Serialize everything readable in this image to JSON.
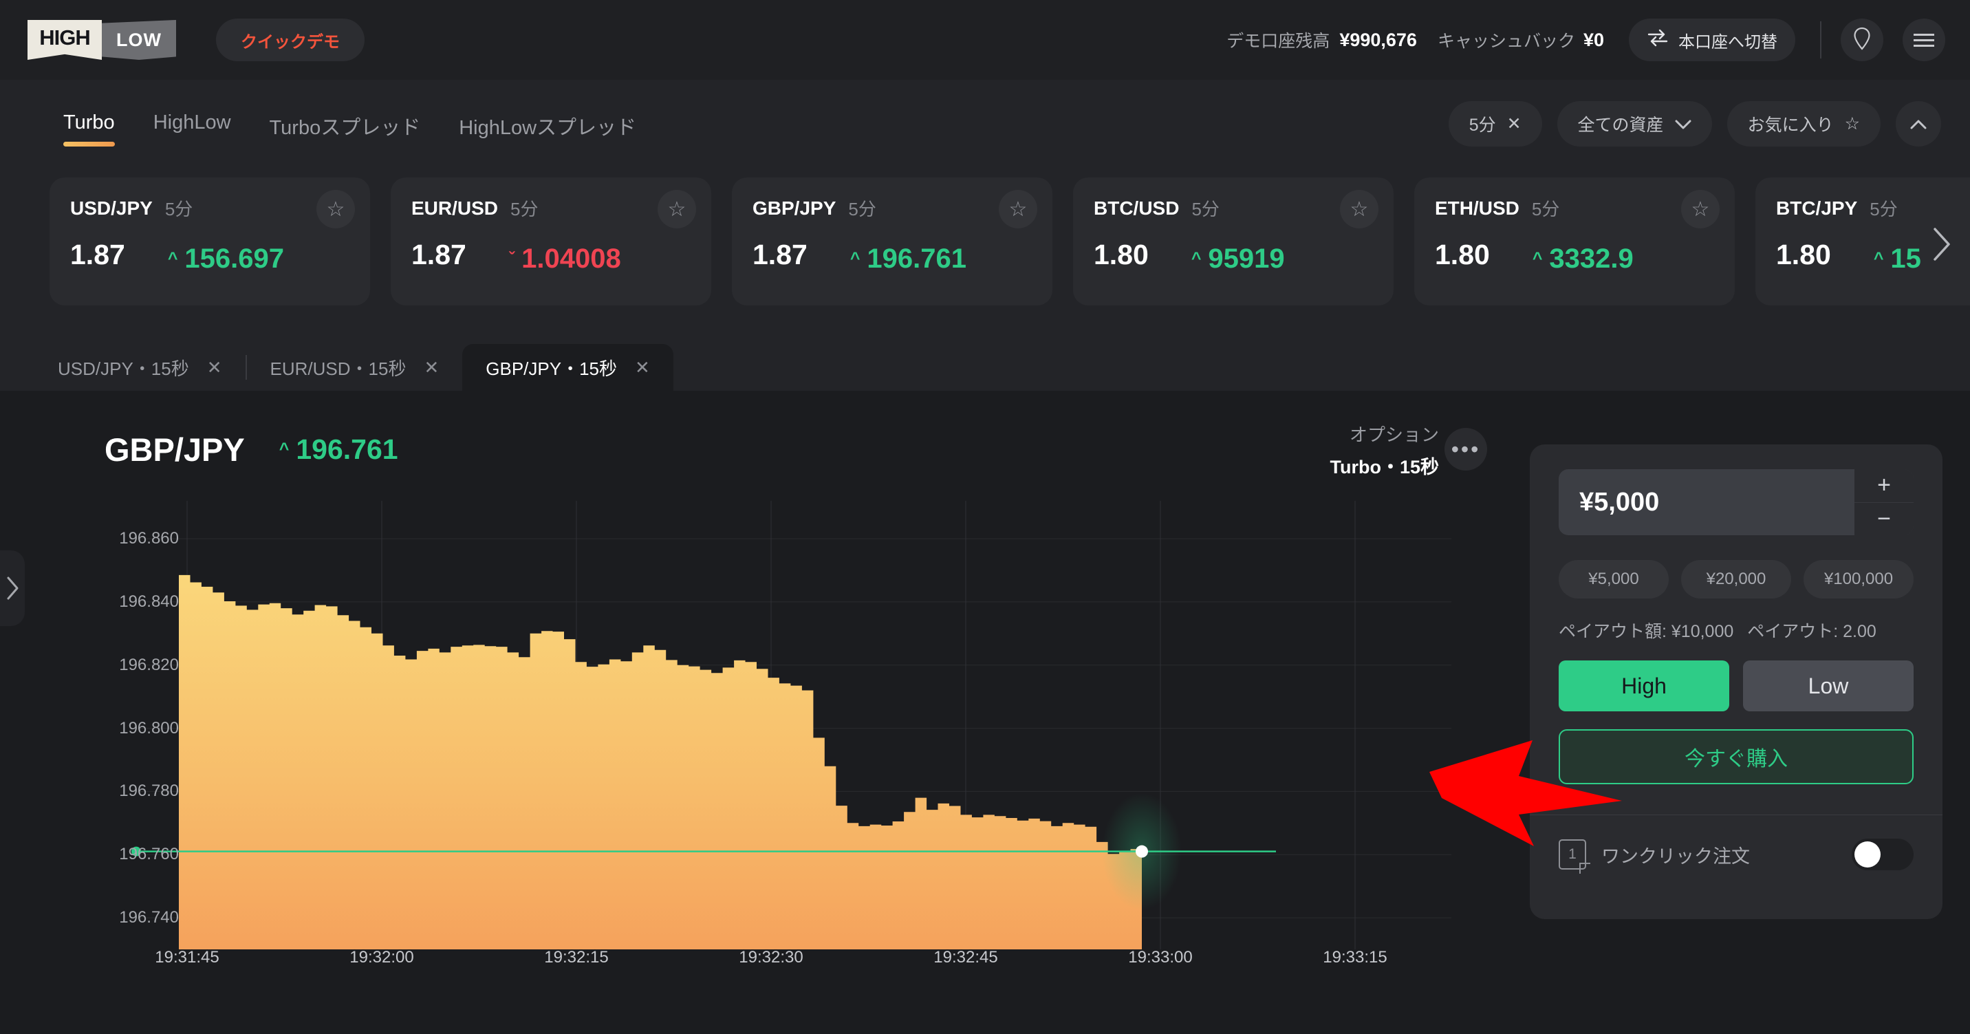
{
  "header": {
    "logo_high": "HIGH",
    "logo_low": "LOW",
    "quick_demo": "クイックデモ",
    "balance_label": "デモ口座残高",
    "balance_value": "¥990,676",
    "cashback_label": "キャッシュバック",
    "cashback_value": "¥0",
    "switch_account": "本口座へ切替",
    "switch_icon": "swap-icon",
    "notification_icon": "location-pin-icon",
    "menu_icon": "hamburger-menu-icon"
  },
  "nav": {
    "tabs": [
      {
        "label": "Turbo",
        "active": true
      },
      {
        "label": "HighLow",
        "active": false
      },
      {
        "label": "Turboスプレッド",
        "active": false
      },
      {
        "label": "HighLowスプレッド",
        "active": false
      }
    ],
    "filters": {
      "duration": "5分",
      "duration_close": "✕",
      "asset_filter": "全ての資産",
      "favorites": "お気に入り",
      "collapse": "^"
    }
  },
  "assets": [
    {
      "name": "USD/JPY",
      "duration": "5分",
      "multiplier": "1.87",
      "price": "156.697",
      "dir": "up",
      "caret": "^"
    },
    {
      "name": "EUR/USD",
      "duration": "5分",
      "multiplier": "1.87",
      "price": "1.04008",
      "dir": "down",
      "caret": "ˇ"
    },
    {
      "name": "GBP/JPY",
      "duration": "5分",
      "multiplier": "1.87",
      "price": "196.761",
      "dir": "up",
      "caret": "^"
    },
    {
      "name": "BTC/USD",
      "duration": "5分",
      "multiplier": "1.80",
      "price": "95919",
      "dir": "up",
      "caret": "^"
    },
    {
      "name": "ETH/USD",
      "duration": "5分",
      "multiplier": "1.80",
      "price": "3332.9",
      "dir": "up",
      "caret": "^"
    },
    {
      "name": "BTC/JPY",
      "duration": "5分",
      "multiplier": "1.80",
      "price": "15",
      "dir": "up",
      "caret": "^"
    }
  ],
  "chart_tabs": [
    {
      "label": "USD/JPY・15秒",
      "close": "✕",
      "active": false
    },
    {
      "label": "EUR/USD・15秒",
      "close": "✕",
      "active": false
    },
    {
      "label": "GBP/JPY・15秒",
      "close": "✕",
      "active": true
    }
  ],
  "chart_header": {
    "symbol": "GBP/JPY",
    "price": "196.761",
    "caret": "^",
    "option_label": "オプション",
    "option_value": "Turbo・15秒",
    "more_icon": "ellipsis-icon"
  },
  "panel": {
    "amount_value": "¥5,000",
    "increment": "+",
    "decrement": "−",
    "quick_amounts": [
      "¥5,000",
      "¥20,000",
      "¥100,000"
    ],
    "payout_amount_label": "ペイアウト額: ¥10,000",
    "payout_rate_label": "ペイアウト: 2.00",
    "high_label": "High",
    "low_label": "Low",
    "buy_label": "今すぐ購入",
    "oneclick_label": "ワンクリック注文",
    "oneclick_icon": "one-click-icon",
    "oneclick_on": true
  },
  "colors": {
    "accent_green": "#2ecc87",
    "accent_red": "#f04452",
    "brand_orange": "#f0a84e",
    "panel_bg": "#2a2b2f",
    "page_bg": "#1b1c1f"
  },
  "chart_data": {
    "type": "area",
    "title": "GBP/JPY",
    "xlabel": "",
    "ylabel": "",
    "grid": true,
    "legend": "none",
    "ylim": [
      196.73,
      196.872
    ],
    "yticks": [
      "196.860",
      "196.840",
      "196.820",
      "196.800",
      "196.780",
      "196.760",
      "196.740"
    ],
    "ytick_values": [
      196.86,
      196.84,
      196.82,
      196.8,
      196.78,
      196.76,
      196.74
    ],
    "xticks": [
      "19:31:45",
      "19:32:00",
      "19:32:15",
      "19:32:30",
      "19:32:45",
      "19:33:00",
      "19:33:15"
    ],
    "current_price": 196.761,
    "current_price_line_color": "#2ecc87",
    "area_gradient": [
      "#f8d77a",
      "#f5a35c"
    ],
    "series": [
      {
        "name": "GBP/JPY",
        "values": [
          196.8485,
          196.8462,
          196.8448,
          196.843,
          196.8402,
          196.8388,
          196.8375,
          196.8392,
          196.8396,
          196.838,
          196.836,
          196.8372,
          196.839,
          196.8386,
          196.8358,
          196.834,
          196.832,
          196.83,
          196.8262,
          196.823,
          196.8218,
          196.8245,
          196.8252,
          196.824,
          196.8258,
          196.8262,
          196.8264,
          196.826,
          196.8258,
          196.824,
          196.8225,
          196.83,
          196.8308,
          196.8306,
          196.8282,
          196.821,
          196.8195,
          196.8202,
          196.8218,
          196.8212,
          196.824,
          196.8262,
          196.8248,
          196.8216,
          196.82,
          196.8196,
          196.8185,
          196.8175,
          196.8192,
          196.8215,
          196.821,
          196.8188,
          196.816,
          196.8142,
          196.8135,
          196.812,
          196.797,
          196.788,
          196.7755,
          196.77,
          196.769,
          196.7695,
          196.7692,
          196.7705,
          196.7735,
          196.778,
          196.7742,
          196.7762,
          196.7754,
          196.7726,
          196.7718,
          196.7726,
          196.7722,
          196.7716,
          196.7708,
          196.7714,
          196.7706,
          196.769,
          196.77,
          196.7695,
          196.7688,
          196.764,
          196.7602,
          196.7608,
          196.7618,
          196.762
        ]
      }
    ]
  }
}
